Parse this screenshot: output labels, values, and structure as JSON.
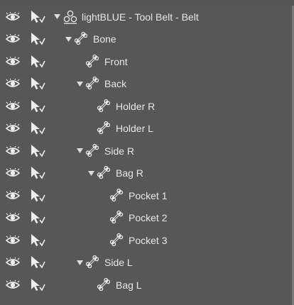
{
  "tree": {
    "rows": [
      {
        "label": "lightBLUE - Tool Belt - Belt",
        "icon": "figure-icon",
        "expanded": true
      },
      {
        "label": "Bone",
        "icon": "bone-icon",
        "expanded": true
      },
      {
        "label": "Front",
        "icon": "bone-icon",
        "expanded": null
      },
      {
        "label": "Back",
        "icon": "bone-icon",
        "expanded": true
      },
      {
        "label": "Holder R",
        "icon": "bone-icon",
        "expanded": null
      },
      {
        "label": "Holder L",
        "icon": "bone-icon",
        "expanded": null
      },
      {
        "label": "Side R",
        "icon": "bone-icon",
        "expanded": true
      },
      {
        "label": "Bag R",
        "icon": "bone-icon",
        "expanded": true
      },
      {
        "label": "Pocket 1",
        "icon": "bone-icon",
        "expanded": null
      },
      {
        "label": "Pocket 2",
        "icon": "bone-icon",
        "expanded": null
      },
      {
        "label": "Pocket 3",
        "icon": "bone-icon",
        "expanded": null
      },
      {
        "label": "Side L",
        "icon": "bone-icon",
        "expanded": true
      },
      {
        "label": "Bag L",
        "icon": "bone-icon",
        "expanded": null
      }
    ]
  },
  "colors": {
    "background": "#575757",
    "text": "#e8e8e8",
    "icon": "#eeeeee"
  }
}
